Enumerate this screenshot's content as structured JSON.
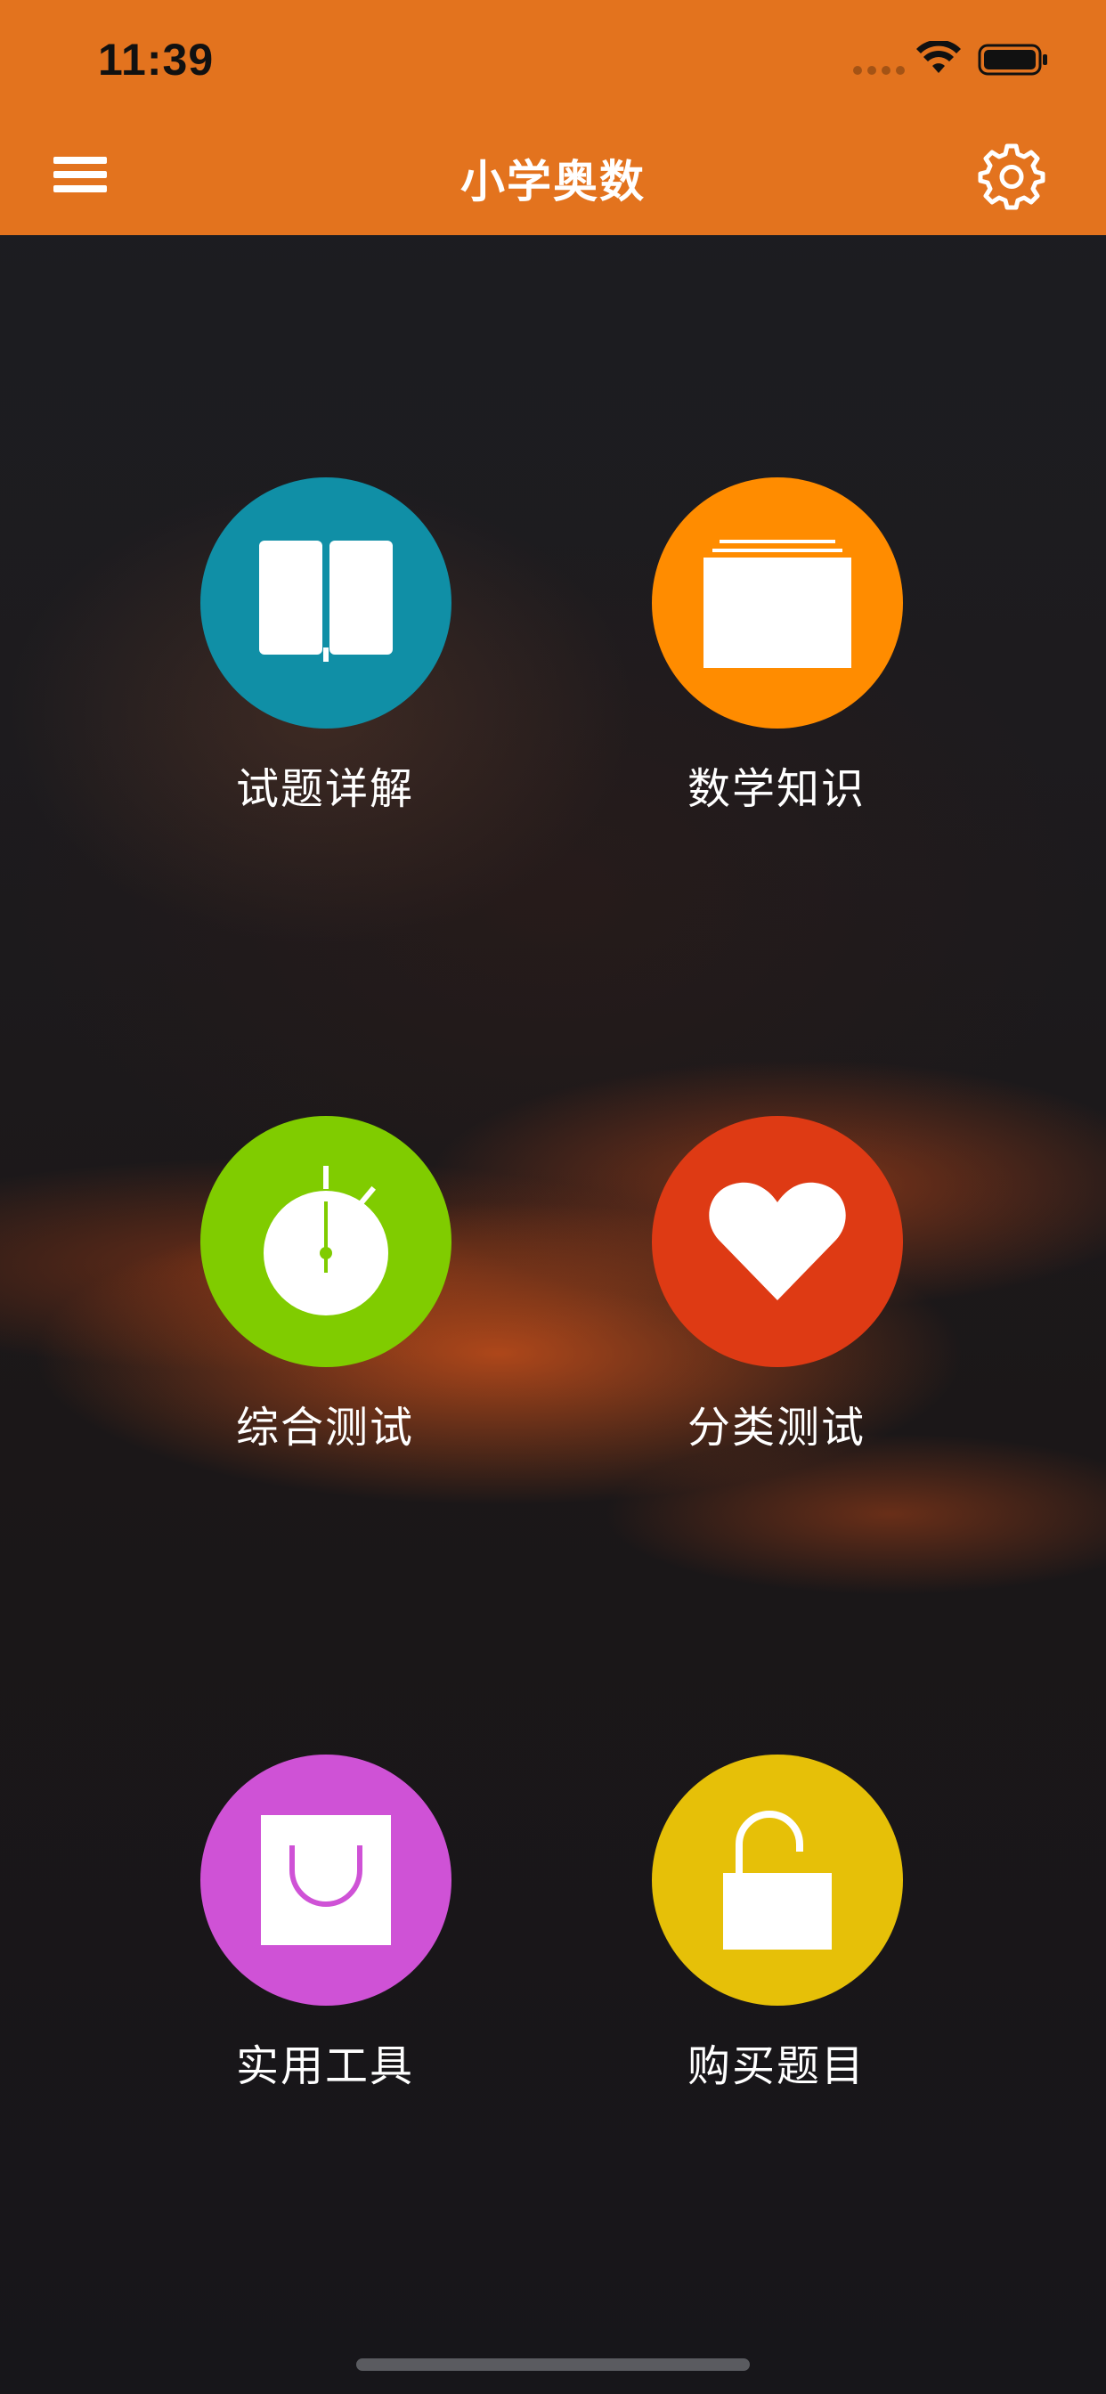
{
  "status_bar": {
    "time": "11:39"
  },
  "header": {
    "title": "小学奥数",
    "menu_icon": "hamburger-menu-icon",
    "settings_icon": "gear-icon"
  },
  "colors": {
    "header_bg": "#e3731e",
    "teal": "#108fa6",
    "orange": "#ff8c00",
    "green": "#80cc00",
    "red": "#de3a14",
    "purple": "#cf52d6",
    "yellow": "#e6c008"
  },
  "tiles": [
    {
      "label": "试题详解",
      "icon": "open-book-icon",
      "color": "#108fa6"
    },
    {
      "label": "数学知识",
      "icon": "stacked-cards-icon",
      "color": "#ff8c00"
    },
    {
      "label": "综合测试",
      "icon": "stopwatch-icon",
      "color": "#80cc00"
    },
    {
      "label": "分类测试",
      "icon": "heart-icon",
      "color": "#de3a14"
    },
    {
      "label": "实用工具",
      "icon": "shopping-bag-icon",
      "color": "#cf52d6"
    },
    {
      "label": "购买题目",
      "icon": "unlocked-padlock-icon",
      "color": "#e6c008"
    }
  ]
}
